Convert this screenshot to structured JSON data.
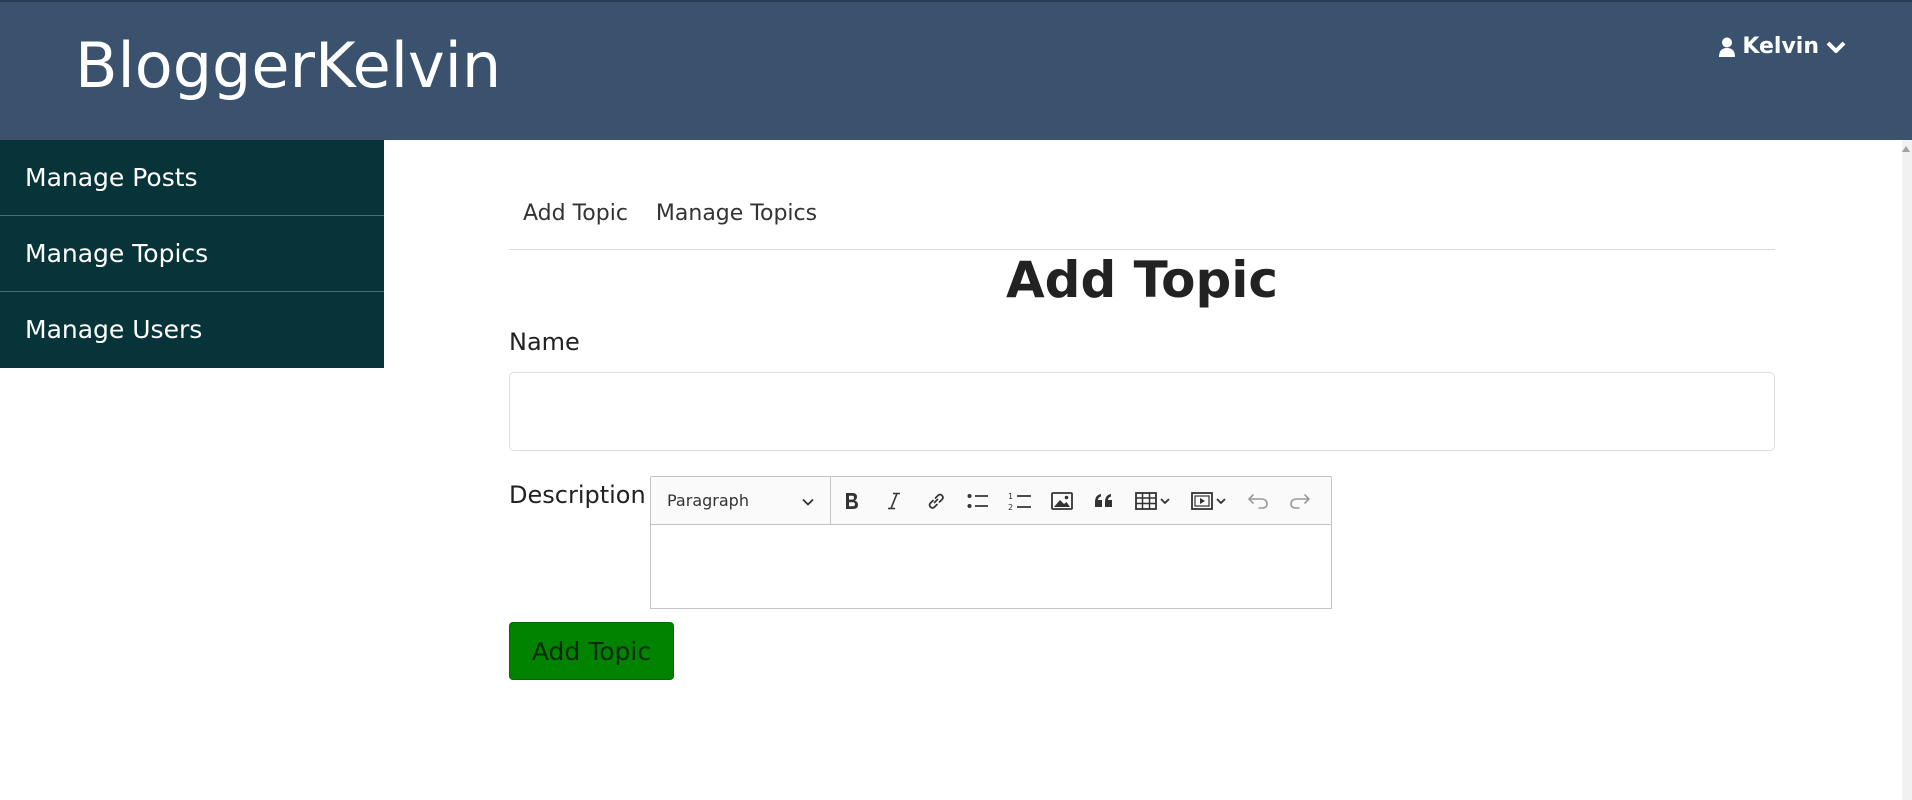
{
  "header": {
    "logo": "BloggerKelvin",
    "user_name": "Kelvin"
  },
  "sidebar": {
    "items": [
      {
        "label": "Manage Posts"
      },
      {
        "label": "Manage Topics"
      },
      {
        "label": "Manage Users"
      }
    ]
  },
  "subnav": {
    "items": [
      {
        "label": "Add Topic"
      },
      {
        "label": "Manage Topics"
      }
    ]
  },
  "form": {
    "title": "Add Topic",
    "name_label": "Name",
    "name_value": "",
    "description_label": "Description",
    "editor_heading_select": "Paragraph",
    "editor_body": "",
    "submit_label": "Add Topic"
  },
  "icons": {
    "user": "user-icon",
    "user_dropdown": "chevron-down-icon",
    "bold": "bold-icon",
    "italic": "italic-icon",
    "link": "link-icon",
    "bulleted_list": "bulleted-list-icon",
    "numbered_list": "numbered-list-icon",
    "image": "image-icon",
    "quote": "quote-icon",
    "table": "table-icon",
    "media": "media-icon",
    "undo": "undo-icon",
    "redo": "redo-icon"
  },
  "colors": {
    "header_bg": "#3b526e",
    "sidebar_bg": "#073439",
    "submit_bg": "#028300"
  }
}
